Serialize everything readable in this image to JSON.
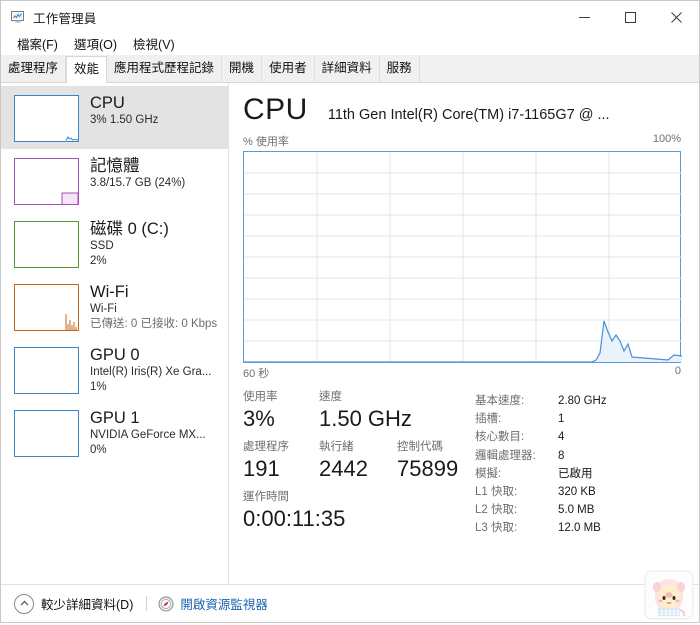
{
  "window": {
    "title": "工作管理員",
    "icon": "task-manager-icon",
    "controls": {
      "minimize": "最小化",
      "maximize": "最大化",
      "close": "關閉"
    }
  },
  "menu": {
    "items": [
      {
        "label": "檔案(F)"
      },
      {
        "label": "選項(O)"
      },
      {
        "label": "檢視(V)"
      }
    ]
  },
  "tabs": [
    {
      "label": "處理程序",
      "active": false
    },
    {
      "label": "效能",
      "active": true
    },
    {
      "label": "應用程式歷程記錄",
      "active": false
    },
    {
      "label": "開機",
      "active": false
    },
    {
      "label": "使用者",
      "active": false
    },
    {
      "label": "詳細資料",
      "active": false
    },
    {
      "label": "服務",
      "active": false
    }
  ],
  "sidebar": {
    "items": [
      {
        "name": "cpu",
        "title": "CPU",
        "line2": "3%  1.50 GHz",
        "line3": "",
        "color": "#3b86c9",
        "selected": true
      },
      {
        "name": "memory",
        "title": "記憶體",
        "line2": "3.8/15.7 GB (24%)",
        "line3": "",
        "color": "#a84fb8",
        "selected": false
      },
      {
        "name": "disk0",
        "title": "磁碟 0 (C:)",
        "line2": "SSD",
        "line3": "2%",
        "color": "#4f9b2f",
        "selected": false
      },
      {
        "name": "wifi",
        "title": "Wi-Fi",
        "line2": "Wi-Fi",
        "line3": "已傳送: 0 已接收: 0 Kbps",
        "color": "#c06820",
        "selected": false
      },
      {
        "name": "gpu0",
        "title": "GPU 0",
        "line2": "Intel(R) Iris(R) Xe Gra...",
        "line3": "1%",
        "color": "#3b86c9",
        "selected": false
      },
      {
        "name": "gpu1",
        "title": "GPU 1",
        "line2": "NVIDIA GeForce MX...",
        "line3": "0%",
        "color": "#3b86c9",
        "selected": false
      }
    ]
  },
  "main": {
    "title": "CPU",
    "subtitle": "11th Gen Intel(R) Core(TM) i7-1165G7 @ ...",
    "graph": {
      "y_label": "% 使用率",
      "y_max": "100%",
      "x_label": "60 秒",
      "x_min": "0",
      "line_color": "#4a90d9",
      "fill_color": "#eaf3fb",
      "grid_color": "#d9e7f3"
    },
    "stats": [
      {
        "label": "使用率",
        "value": "3%"
      },
      {
        "label": "速度",
        "value": "1.50 GHz"
      },
      {
        "label": "處理程序",
        "value": "191"
      },
      {
        "label": "執行緒",
        "value": "2442"
      },
      {
        "label": "控制代碼",
        "value": "75899"
      },
      {
        "label": "運作時間",
        "value": "0:00:11:35"
      }
    ],
    "details": [
      {
        "label": "基本速度:",
        "value": "2.80 GHz"
      },
      {
        "label": "插槽:",
        "value": "1"
      },
      {
        "label": "核心數目:",
        "value": "4"
      },
      {
        "label": "邏輯處理器:",
        "value": "8"
      },
      {
        "label": "模擬:",
        "value": "已啟用"
      },
      {
        "label": "L1 快取:",
        "value": "320 KB"
      },
      {
        "label": "L2 快取:",
        "value": "5.0 MB"
      },
      {
        "label": "L3 快取:",
        "value": "12.0 MB"
      }
    ]
  },
  "footer": {
    "fewer_details": "較少詳細資料(D)",
    "resource_monitor": "開啟資源監視器"
  },
  "chart_data": {
    "type": "area",
    "title": "CPU 使用率",
    "ylabel": "% 使用率",
    "xlabel": "60 秒",
    "ylim": [
      0,
      100
    ],
    "xlim": [
      60,
      0
    ],
    "grid": true,
    "series": [
      {
        "name": "% 使用率",
        "x": [
          60,
          48,
          43.5,
          43,
          42,
          41,
          40,
          39,
          38,
          37,
          36,
          35,
          34,
          33,
          32,
          31,
          30,
          29,
          28,
          27,
          26,
          25,
          24,
          23,
          22,
          21,
          20,
          19,
          18,
          17,
          16,
          15,
          14,
          13,
          12,
          11,
          10,
          9,
          8,
          7,
          6,
          5,
          4,
          3,
          2,
          1,
          0
        ],
        "values": [
          0,
          0,
          0,
          0,
          0,
          0,
          0,
          0,
          0,
          0,
          0,
          0,
          0,
          0,
          0,
          0,
          0,
          0,
          0,
          0,
          0,
          0,
          0,
          0,
          0,
          0,
          0,
          0,
          0,
          0,
          0,
          0,
          0,
          0,
          0.5,
          1,
          14,
          10,
          8,
          10,
          8,
          5,
          3,
          6,
          1.5,
          1,
          3
        ]
      }
    ]
  }
}
